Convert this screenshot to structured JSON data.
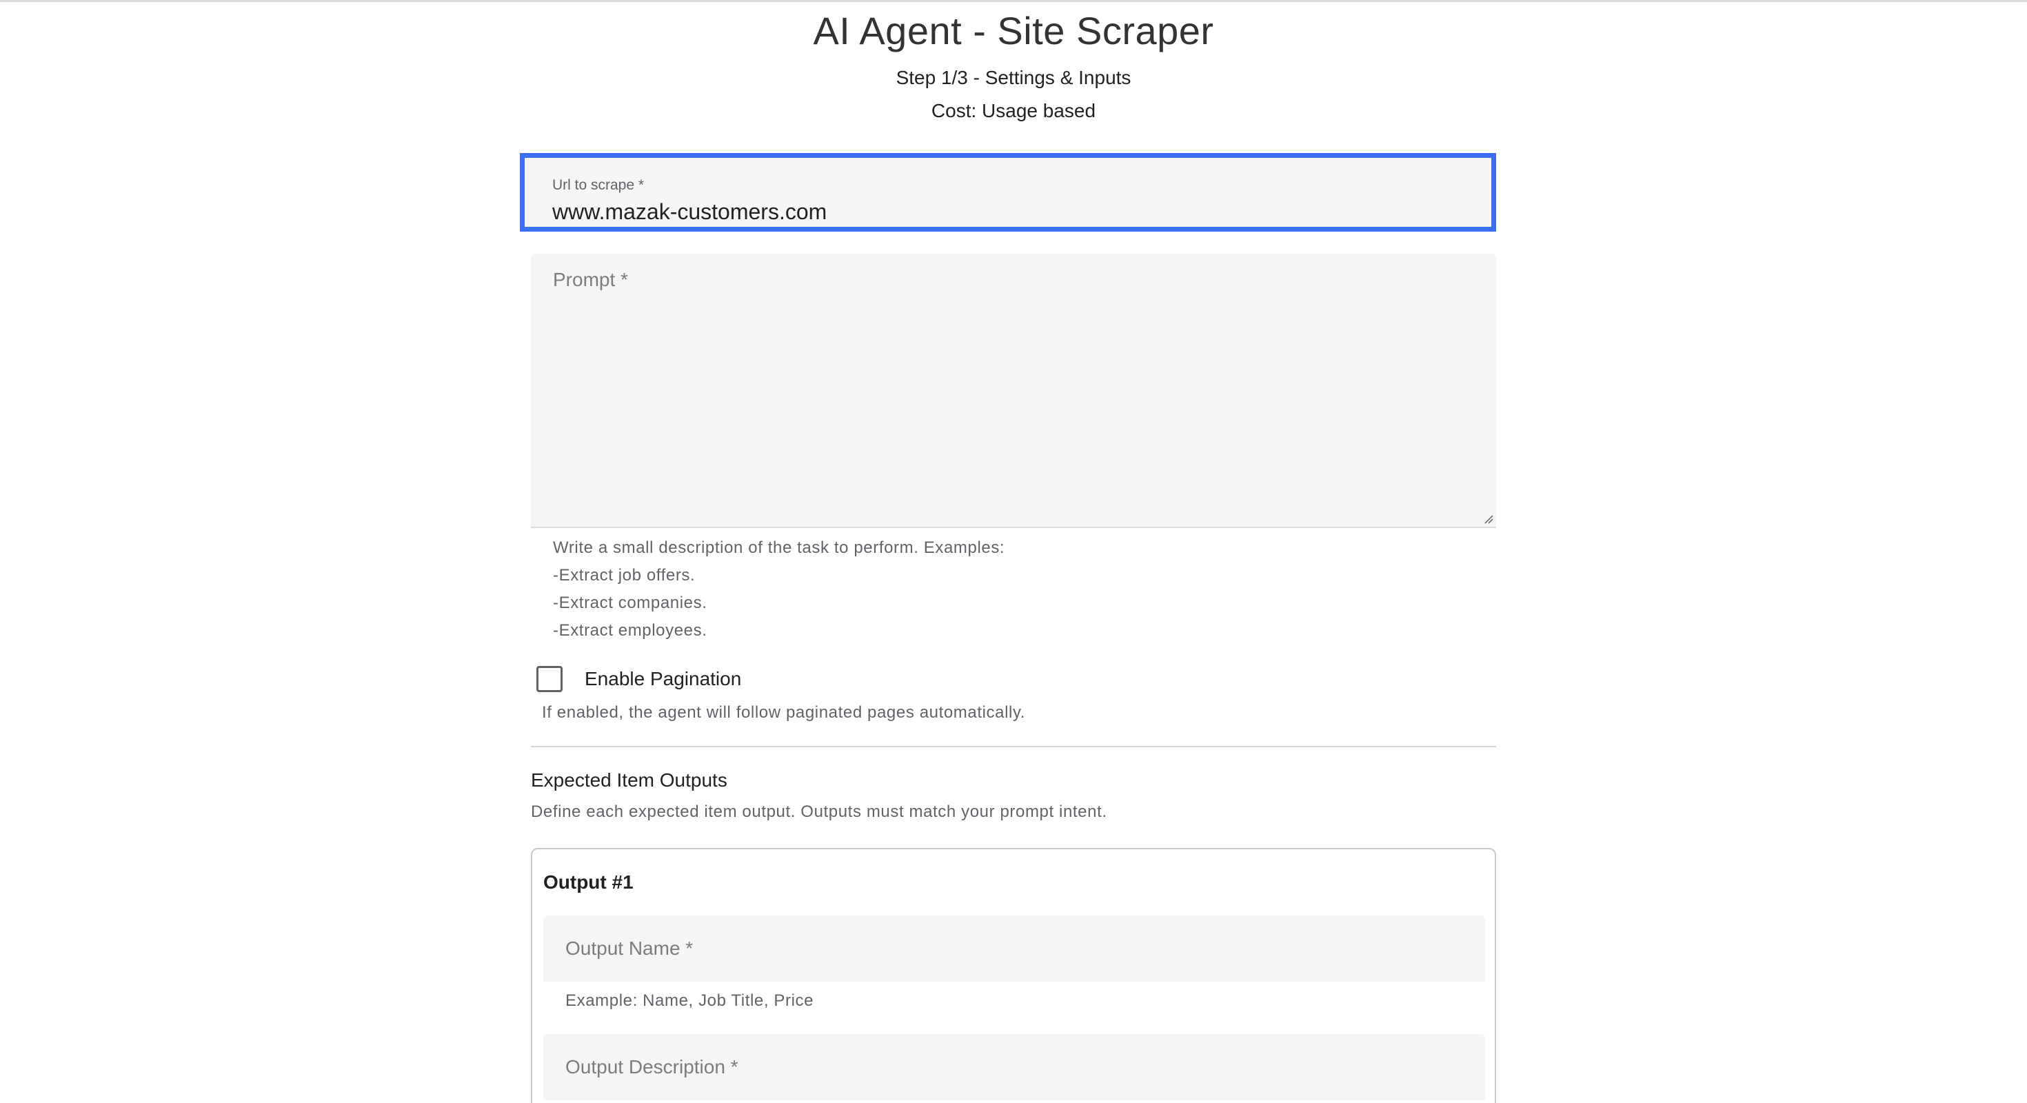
{
  "header": {
    "title": "AI Agent - Site Scraper",
    "step": "Step 1/3 - Settings & Inputs",
    "cost": "Cost: Usage based"
  },
  "url_field": {
    "label": "Url to scrape *",
    "value": "www.mazak-customers.com",
    "focus_color": "#3b6ef5"
  },
  "prompt_field": {
    "placeholder": "Prompt *",
    "helper_lines": [
      "Write a small description of the task to perform. Examples:",
      "-Extract job offers.",
      "-Extract companies.",
      "-Extract employees."
    ]
  },
  "pagination": {
    "label": "Enable Pagination",
    "checked": false,
    "hint": "If enabled, the agent will follow paginated pages automatically."
  },
  "outputs_section": {
    "title": "Expected Item Outputs",
    "description": "Define each expected item output. Outputs must match your prompt intent.",
    "outputs": [
      {
        "title": "Output #1",
        "name_placeholder": "Output Name *",
        "name_hint": "Example: Name, Job Title, Price",
        "description_placeholder": "Output Description *"
      }
    ]
  }
}
